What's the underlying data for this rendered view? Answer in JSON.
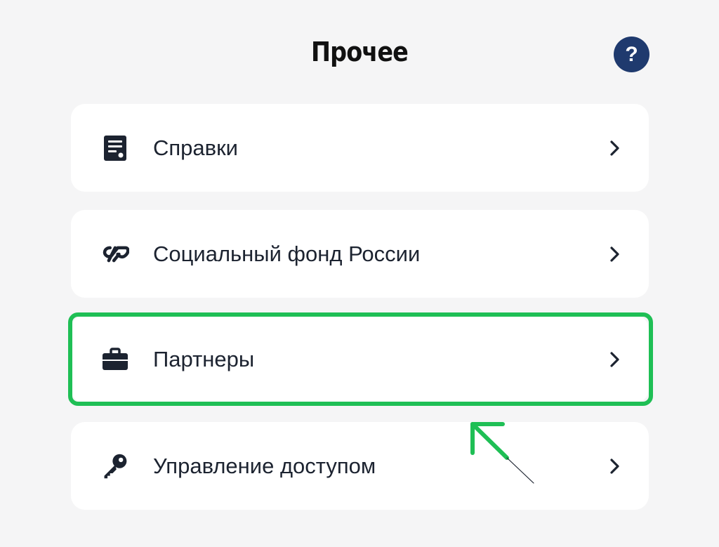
{
  "header": {
    "title": "Прочее",
    "help_label": "?"
  },
  "menu": {
    "items": [
      {
        "label": "Справки",
        "icon": "document-icon"
      },
      {
        "label": "Социальный фонд России",
        "icon": "sfr-logo-icon"
      },
      {
        "label": "Партнеры",
        "icon": "briefcase-icon"
      },
      {
        "label": "Управление доступом",
        "icon": "key-icon"
      }
    ]
  },
  "annotation": {
    "highlight_color": "#1fbf55",
    "highlighted_item": "Партнеры"
  },
  "colors": {
    "background": "#f5f5f6",
    "card": "#ffffff",
    "text": "#1c2330",
    "help_button": "#1f3a6e",
    "highlight": "#1fbf55"
  }
}
